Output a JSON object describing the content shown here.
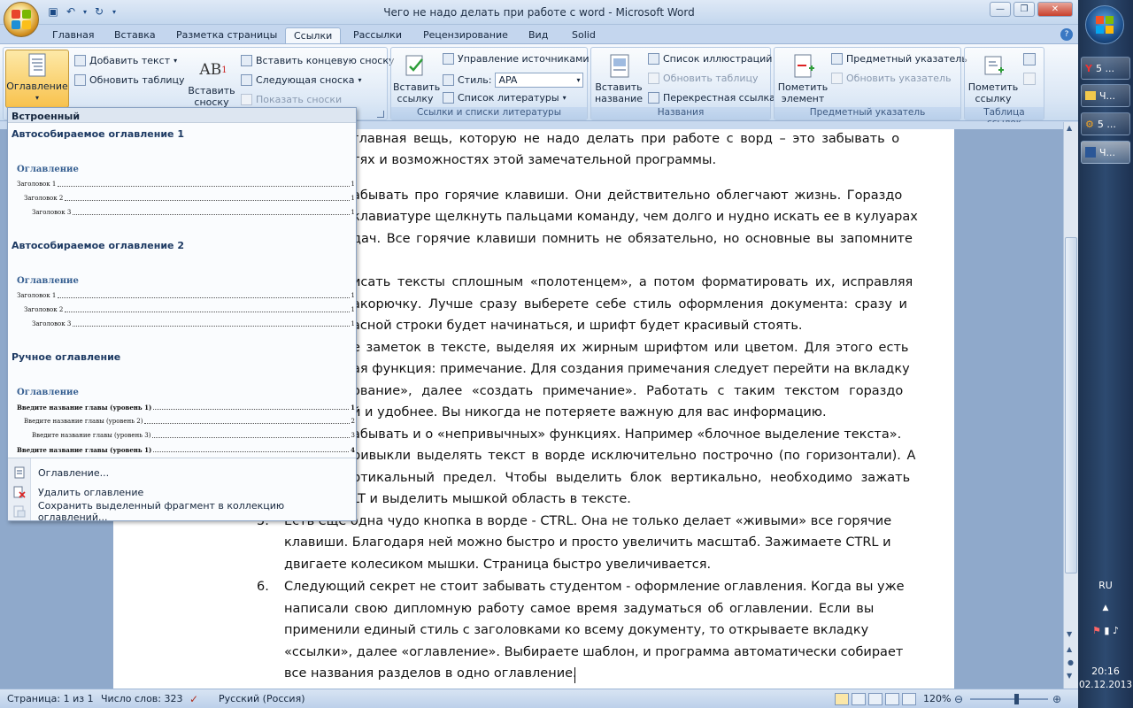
{
  "window": {
    "title": "Чего не надо делать при работе с word - Microsoft Word"
  },
  "tabs": [
    "Главная",
    "Вставка",
    "Разметка страницы",
    "Ссылки",
    "Рассылки",
    "Рецензирование",
    "Вид",
    "Solid"
  ],
  "ribbon": {
    "toc_label": "Оглавление",
    "add_text": "Добавить текст",
    "update_table": "Обновить таблицу",
    "insert_footnote": "Вставить сноску",
    "insert_endnote": "Вставить концевую сноску",
    "next_footnote": "Следующая сноска",
    "show_notes": "Показать сноски",
    "insert_citation": "Вставить ссылку",
    "manage_sources": "Управление источниками",
    "style_label": "Стиль:",
    "style_value": "APA",
    "bibliography": "Список литературы",
    "citations_group": "Ссылки и списки литературы",
    "insert_caption": "Вставить название",
    "table_of_figures": "Список иллюстраций",
    "update_table2": "Обновить таблицу",
    "cross_reference": "Перекрестная ссылка",
    "captions_group": "Названия",
    "mark_entry": "Пометить элемент",
    "insert_index": "Предметный указатель",
    "update_index": "Обновить указатель",
    "index_group": "Предметный указатель",
    "mark_citation": "Пометить ссылку",
    "toa_group": "Таблица ссылок"
  },
  "dropdown": {
    "header": "Встроенный",
    "auto1": "Автособираемое оглавление 1",
    "auto2": "Автособираемое оглавление 2",
    "manual": "Ручное оглавление",
    "toc_heading": "Оглавление",
    "auto_entries": [
      "Заголовок 1",
      "Заголовок 2",
      "Заголовок 3"
    ],
    "manual_entries": [
      "Введите название главы (уровень 1)",
      "Введите название главы (уровень 2)",
      "Введите название главы (уровень 3)",
      "Введите название главы (уровень 1)"
    ],
    "manual_pages": [
      "1",
      "2",
      "3",
      "4"
    ],
    "cmd_toc": "Оглавление...",
    "cmd_remove": "Удалить оглавление",
    "cmd_save": "Сохранить выделенный фрагмент в коллекцию оглавлений..."
  },
  "document": {
    "lines": [
      "главная вещь, которую не надо делать при работе с ворд – это забывать о",
      "тях и возможностях этой замечательной программы.",
      "абывать про горячие клавиши. Они действительно облегчают жизнь. Гораздо",
      "клавиатуре щелкнуть пальцами команду, чем долго и нудно искать ее в кулуарах",
      "дач. Все горячие клавиши помнить не обязательно, но основные вы запомните",
      "исать тексты сплошным «полотенцем», а потом форматировать их, исправляя",
      "акорючку. Лучше сразу выберете себе стиль оформления документа: сразу и",
      "асной строки будет начинаться, и шрифт будет красивый стоять.",
      "е заметок в тексте, выделяя их жирным шрифтом или цветом. Для этого есть",
      "ая функция: примечание. Для создания примечания следует перейти на вкладку",
      "ование», далее «создать примечание». Работать с таким текстом гораздо",
      "й и удобнее. Вы никогда не потеряете важную для вас информацию.",
      "абывать и о «непривычных» функциях. Например «блочное выделение текста».",
      "ривыкли выделять текст в ворде исключительно построчно (по горизонтали). А",
      "ртикальный предел. Чтобы выделить блок вертикально, необходимо зажать",
      "LT и выделить мышкой область в тексте.",
      "Есть еще одна чудо кнопка в ворде  - CTRL. Она не только делает «живыми» все горячие",
      "клавиши. Благодаря ней можно быстро и просто увеличить масштаб. Зажимаете CTRL и",
      "двигаете колесиком мышки. Страница быстро увеличивается.",
      "Следующий секрет не стоит забывать студентом - оформление оглавления.  Когда вы уже",
      "написали свою дипломную работу самое время задуматься об оглавлении.  Если вы",
      "применили единый стиль с заголовками ко всему документу, то открываете вкладку",
      "«ссылки», далее «оглавление». Выбираете шаблон, и программа автоматически собирает",
      "все названия разделов в одно оглавление."
    ],
    "numbers": [
      "5.",
      "6."
    ]
  },
  "status": {
    "page": "Страница: 1 из 1",
    "words": "Число слов: 323",
    "language": "Русский (Россия)",
    "zoom": "120%"
  },
  "taskbar": {
    "items": [
      "5 ...",
      "Ч...",
      "5 ...",
      "Ч..."
    ],
    "lang": "RU",
    "time": "20:16",
    "date": "02.12.2013"
  }
}
